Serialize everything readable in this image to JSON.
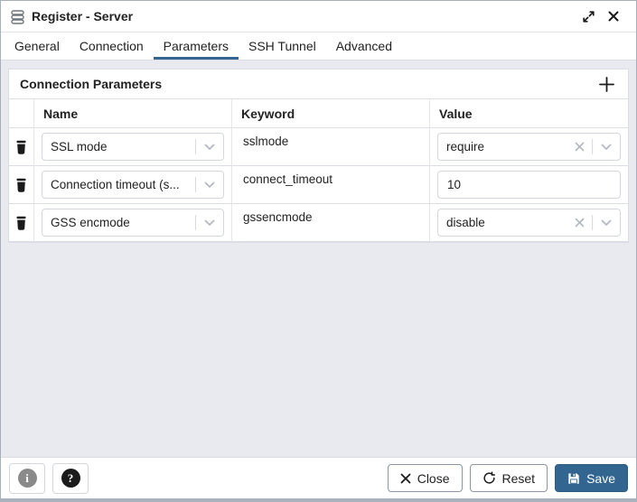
{
  "window": {
    "title": "Register - Server"
  },
  "tabs": [
    {
      "label": "General",
      "active": false
    },
    {
      "label": "Connection",
      "active": false
    },
    {
      "label": "Parameters",
      "active": true
    },
    {
      "label": "SSH Tunnel",
      "active": false
    },
    {
      "label": "Advanced",
      "active": false
    }
  ],
  "panel": {
    "title": "Connection Parameters"
  },
  "table": {
    "columns": [
      "Name",
      "Keyword",
      "Value"
    ],
    "rows": [
      {
        "name": "SSL mode",
        "keyword": "sslmode",
        "value": "require",
        "value_widget": "select-clearable"
      },
      {
        "name": "Connection timeout (s...",
        "keyword": "connect_timeout",
        "value": "10",
        "value_widget": "text-input"
      },
      {
        "name": "GSS encmode",
        "keyword": "gssencmode",
        "value": "disable",
        "value_widget": "select-clearable"
      }
    ]
  },
  "footer": {
    "close_label": "Close",
    "reset_label": "Reset",
    "save_label": "Save"
  },
  "colors": {
    "primary": "#326690",
    "body_background": "#e8eaf0",
    "panel_border": "#dadde3"
  }
}
